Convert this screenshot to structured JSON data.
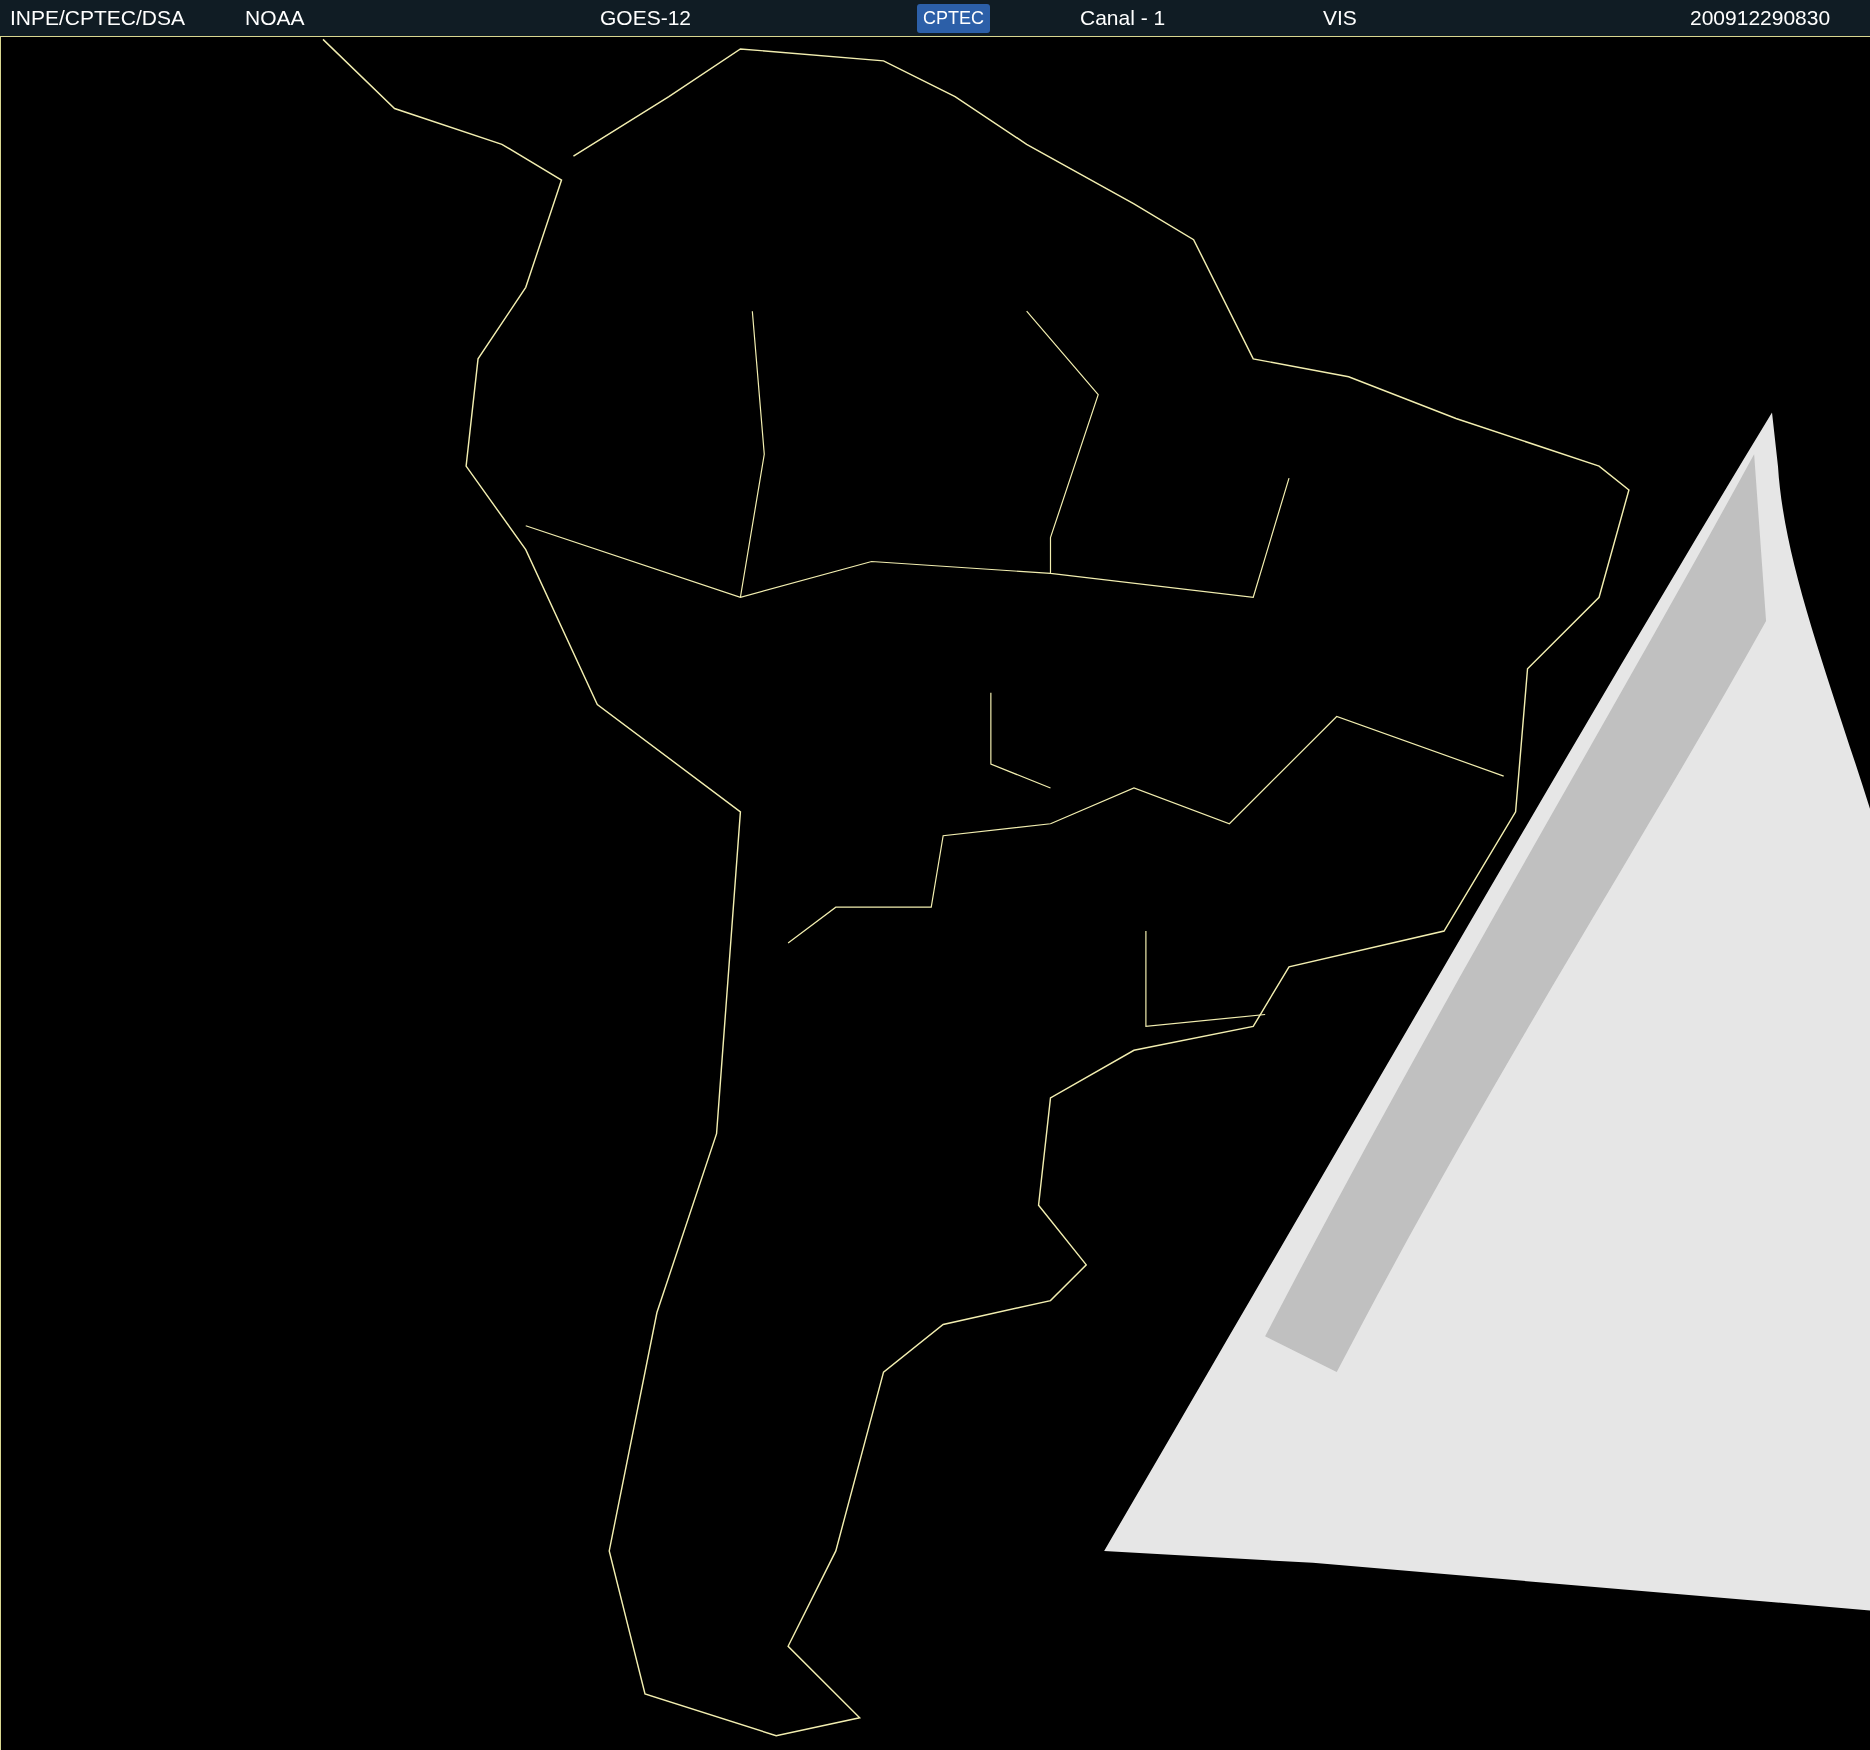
{
  "header": {
    "items": [
      {
        "kind": "text",
        "text": "INPE/CPTEC/DSA"
      },
      {
        "kind": "text",
        "text": "NOAA"
      },
      {
        "kind": "text",
        "text": "GOES-12"
      },
      {
        "kind": "logo",
        "text": "CPTEC"
      },
      {
        "kind": "text",
        "text": "Canal - 1"
      },
      {
        "kind": "text",
        "text": "VIS"
      },
      {
        "kind": "text",
        "text": "200912290830"
      }
    ]
  }
}
